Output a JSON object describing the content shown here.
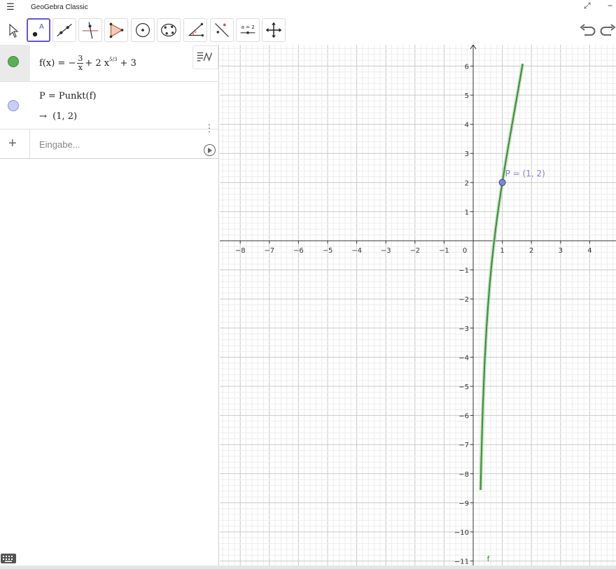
{
  "window": {
    "title": "GeoGebra Classic",
    "menu_icon": "☰",
    "maximize_icon": "⤢",
    "minimize_icon": "−"
  },
  "toolbar": {
    "tools": [
      "move",
      "point",
      "line",
      "perpendicular-line",
      "polygon",
      "circle-center-point",
      "conic-five-points",
      "angle",
      "reflect",
      "slider",
      "move-graphics-view"
    ],
    "active_tool": "point",
    "slider_label": "a = 2"
  },
  "algebra": {
    "rows": [
      {
        "color": "#5cae5a",
        "fx_prefix": "f(x)  =  −",
        "frac_num": "3",
        "frac_den": "x",
        "mid_text": "+ 2 x",
        "exp_num": "5",
        "exp_den": "3",
        "tail_text": "+ 3"
      },
      {
        "color": "#aab3f0",
        "definition": "P = Punkt(f)",
        "arrow": "→",
        "value": "(1, 2)"
      }
    ],
    "input_placeholder": "Eingabe...",
    "add_icon": "+"
  },
  "graph": {
    "x_ticks": [
      "−8",
      "−7",
      "−6",
      "−5",
      "−4",
      "−3",
      "−2",
      "−1",
      "0",
      "1",
      "2",
      "3",
      "4"
    ],
    "y_ticks": [
      "6",
      "5",
      "4",
      "3",
      "2",
      "1",
      "−1",
      "−2",
      "−3",
      "−4",
      "−5",
      "−6",
      "−7",
      "−8",
      "−9",
      "−10",
      "−11"
    ],
    "point_label": "P = (1, 2)",
    "curve_label": "f",
    "curve_color": "#3f8a3a",
    "point_color": "#7a86d8"
  }
}
